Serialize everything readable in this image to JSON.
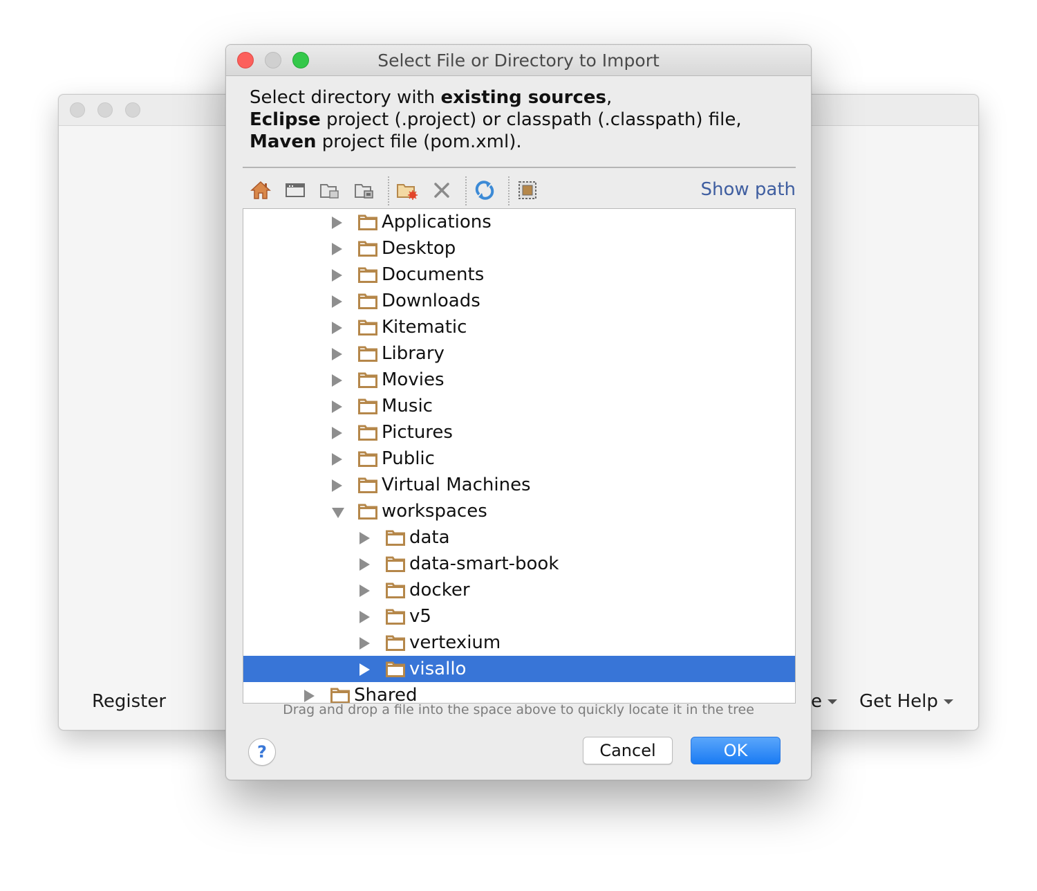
{
  "background_window": {
    "register_label": "Register",
    "partial_menu_label": "e",
    "get_help_label": "Get Help"
  },
  "dialog": {
    "title": "Select File or Directory to Import",
    "description": {
      "line1_pre": "Select directory with ",
      "line1_bold": "existing sources",
      "line1_post": ",",
      "line2_bold": "Eclipse",
      "line2_post": " project (.project) or classpath (.classpath) file,",
      "line3_bold": "Maven",
      "line3_post": " project file (pom.xml)."
    },
    "toolbar": {
      "icons": [
        "home-icon",
        "desktop-icon",
        "project-folder-icon",
        "module-folder-icon",
        "new-folder-icon",
        "delete-icon",
        "refresh-icon",
        "hidden-files-icon"
      ],
      "show_path_label": "Show path"
    },
    "tree": [
      {
        "label": "Applications",
        "level": 1,
        "state": "collapsed"
      },
      {
        "label": "Desktop",
        "level": 1,
        "state": "collapsed"
      },
      {
        "label": "Documents",
        "level": 1,
        "state": "collapsed"
      },
      {
        "label": "Downloads",
        "level": 1,
        "state": "collapsed"
      },
      {
        "label": "Kitematic",
        "level": 1,
        "state": "collapsed"
      },
      {
        "label": "Library",
        "level": 1,
        "state": "collapsed"
      },
      {
        "label": "Movies",
        "level": 1,
        "state": "collapsed"
      },
      {
        "label": "Music",
        "level": 1,
        "state": "collapsed"
      },
      {
        "label": "Pictures",
        "level": 1,
        "state": "collapsed"
      },
      {
        "label": "Public",
        "level": 1,
        "state": "collapsed"
      },
      {
        "label": "Virtual Machines",
        "level": 1,
        "state": "collapsed"
      },
      {
        "label": "workspaces",
        "level": 1,
        "state": "expanded"
      },
      {
        "label": "data",
        "level": 2,
        "state": "collapsed"
      },
      {
        "label": "data-smart-book",
        "level": 2,
        "state": "collapsed"
      },
      {
        "label": "docker",
        "level": 2,
        "state": "collapsed"
      },
      {
        "label": "v5",
        "level": 2,
        "state": "collapsed"
      },
      {
        "label": "vertexium",
        "level": 2,
        "state": "collapsed"
      },
      {
        "label": "visallo",
        "level": 2,
        "state": "collapsed",
        "selected": true
      },
      {
        "label": "Shared",
        "level": 0,
        "state": "collapsed"
      }
    ],
    "hint": "Drag and drop a file into the space above to quickly locate it in the tree",
    "help_label": "?",
    "cancel_label": "Cancel",
    "ok_label": "OK"
  },
  "colors": {
    "selection": "#3875d7",
    "folder": "#b5874a",
    "ok_button": "#1a7bf3",
    "link": "#3f5ea0"
  }
}
